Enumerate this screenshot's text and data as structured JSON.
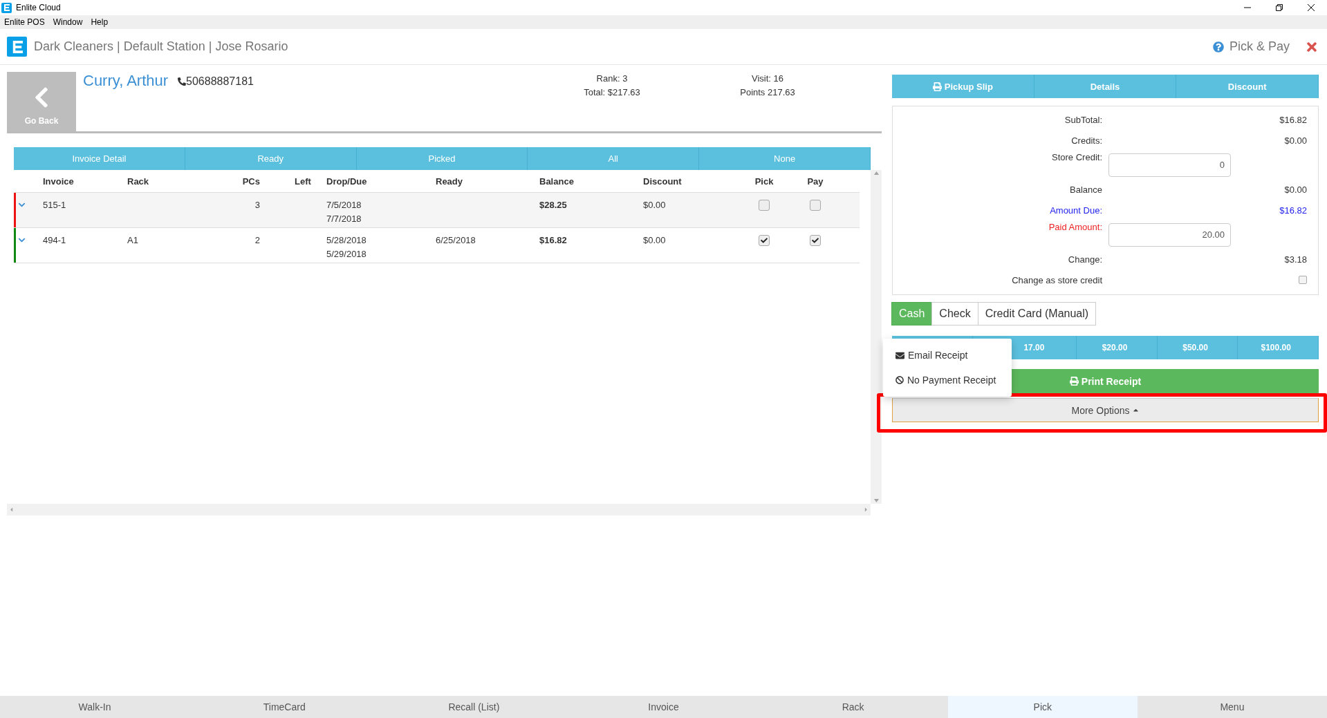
{
  "window": {
    "title": "Enlite Cloud"
  },
  "menu_bar": [
    {
      "label": "Enlite POS"
    },
    {
      "label": "Window"
    },
    {
      "label": "Help"
    }
  ],
  "header": {
    "title": "Dark Cleaners | Default Station | Jose Rosario",
    "page": "Pick & Pay"
  },
  "customer": {
    "back_label": "Go Back",
    "name": "Curry, Arthur",
    "phone": "50688887181",
    "rank": "Rank: 3",
    "total": "Total: $217.63",
    "visit": "Visit: 16",
    "points": "Points 217.63"
  },
  "filter_tabs": [
    {
      "label": "Invoice Detail"
    },
    {
      "label": "Ready"
    },
    {
      "label": "Picked"
    },
    {
      "label": "All"
    },
    {
      "label": "None"
    }
  ],
  "table": {
    "columns": [
      "Invoice",
      "Rack",
      "PCs",
      "Left",
      "Drop/Due",
      "Ready",
      "Balance",
      "Discount",
      "Pick",
      "Pay"
    ],
    "rows": [
      {
        "color": "#ee1111",
        "invoice": "515-1",
        "pcs": "3",
        "drop": "7/5/2018",
        "due": "7/7/2018",
        "balance": "$28.25",
        "discount": "$0.00",
        "pick": false,
        "pay": false
      },
      {
        "color": "#118811",
        "invoice": "494-1",
        "rack": "A1",
        "pcs": "2",
        "drop": "5/28/2018",
        "due": "5/29/2018",
        "ready": "6/25/2018",
        "balance": "$16.82",
        "discount": "$0.00",
        "pick": true,
        "pay": true
      }
    ]
  },
  "actions": [
    {
      "label": "Pickup Slip",
      "kind": "print"
    },
    {
      "label": "Details",
      "kind": "plain"
    },
    {
      "label": "Discount",
      "kind": "plain"
    }
  ],
  "summary": [
    {
      "kind": "value",
      "label": "SubTotal:",
      "value": "$16.82"
    },
    {
      "kind": "value",
      "label": "Credits:",
      "value": "$0.00"
    },
    {
      "kind": "input",
      "label": "Store Credit:",
      "value": "0"
    },
    {
      "kind": "value",
      "label": "Balance",
      "value": "$0.00"
    },
    {
      "kind": "value",
      "label": "Amount Due:",
      "value": "$16.82",
      "color": "#2222ee"
    },
    {
      "kind": "input",
      "label": "Paid Amount:",
      "value": "20.00",
      "color": "#ee2222"
    },
    {
      "kind": "value",
      "label": "Change:",
      "value": "$3.18"
    },
    {
      "kind": "checkbox",
      "label": "Change as store credit",
      "checked": false
    }
  ],
  "payment_methods": [
    {
      "label": "Cash",
      "selected": true
    },
    {
      "label": "Check",
      "selected": false
    },
    {
      "label": "Credit Card (Manual)",
      "selected": false
    }
  ],
  "quick_amounts": [
    "17.00",
    "$20.00",
    "$50.00",
    "$100.00"
  ],
  "print_button": "Print Receipt",
  "more_options": {
    "label": "More Options",
    "expanded": true,
    "items": [
      {
        "label": "Email Receipt",
        "kind": "email"
      },
      {
        "label": "No Payment Receipt",
        "kind": "no-payment"
      }
    ]
  },
  "bottom_nav": [
    {
      "label": "Walk-In",
      "selected": false
    },
    {
      "label": "TimeCard",
      "selected": false
    },
    {
      "label": "Recall (List)",
      "selected": false
    },
    {
      "label": "Invoice",
      "selected": false
    },
    {
      "label": "Rack",
      "selected": false
    },
    {
      "label": "Pick",
      "selected": true
    },
    {
      "label": "Menu",
      "selected": false
    }
  ]
}
